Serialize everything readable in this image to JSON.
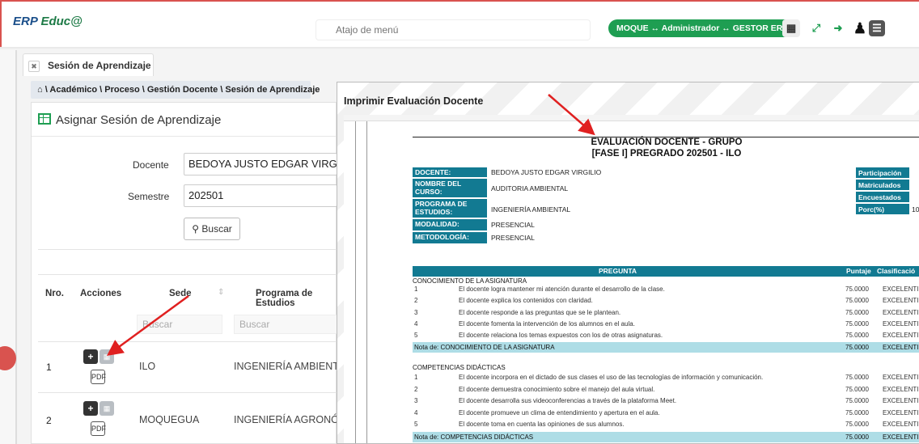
{
  "topbar": {
    "logo_prefix": "ERP",
    "logo_suffix": "Educ@",
    "search_placeholder": "Atajo de menú",
    "role_pill": "MOQUE ↔ Administrador ↔ GESTOR ERP",
    "icons": [
      "apps-grid-icon",
      "fullscreen-icon",
      "logout-icon",
      "user-icon",
      "hamburger-menu-icon"
    ]
  },
  "tab": {
    "label": "Sesión de Aprendizaje"
  },
  "breadcrumb": "\\ Académico \\ Proceso \\ Gestión Docente \\ Sesión de Aprendizaje",
  "panel": {
    "title": "Asignar Sesión de Aprendizaje",
    "docente_label": "Docente",
    "docente_value": "BEDOYA JUSTO EDGAR VIRGILIO",
    "semestre_label": "Semestre",
    "semestre_value": "202501",
    "buscar_label": "Buscar",
    "columns": {
      "nro": "Nro.",
      "acciones": "Acciones",
      "sede": "Sede",
      "programa": "Programa de Estudios"
    },
    "filter_placeholder": "Buscar",
    "rows": [
      {
        "nro": "1",
        "sede": "ILO",
        "programa": "INGENIERÍA AMBIENTAL"
      },
      {
        "nro": "2",
        "sede": "MOQUEGUA",
        "programa": "INGENIERÍA AGRONÓMICA"
      }
    ]
  },
  "modal": {
    "title": "Imprimir Evaluación Docente",
    "doc": {
      "title_line1": "EVALUACIÓN DOCENTE - GRUPO",
      "title_line2": "[FASE I] PREGRADO 202501 - ILO",
      "info": [
        {
          "label": "DOCENTE:",
          "value": "BEDOYA JUSTO EDGAR VIRGILIO"
        },
        {
          "label": "NOMBRE DEL CURSO:",
          "value": "AUDITORIA AMBIENTAL"
        },
        {
          "label": "PROGRAMA DE ESTUDIOS:",
          "value": "INGENIERÍA AMBIENTAL"
        },
        {
          "label": "MODALIDAD:",
          "value": "PRESENCIAL"
        },
        {
          "label": "METODOLOGÍA:",
          "value": "PRESENCIAL"
        }
      ],
      "stats": [
        {
          "label": "Participación",
          "value": ""
        },
        {
          "label": "Matriculados",
          "value": ""
        },
        {
          "label": "Encuestados",
          "value": ""
        },
        {
          "label": "Porc(%)",
          "value": "10"
        }
      ],
      "table_header": {
        "pregunta": "PREGUNTA",
        "puntaje": "Puntaje",
        "clasificacion": "Clasificació"
      },
      "sections": [
        {
          "title": "CONOCIMIENTO DE LA ASIGNATURA",
          "questions": [
            {
              "n": "1",
              "text": "El docente logra mantener mi atención durante el desarrollo de la clase.",
              "score": "75.0000",
              "class": "EXCELENTI"
            },
            {
              "n": "2",
              "text": "El docente explica los contenidos con claridad.",
              "score": "75.0000",
              "class": "EXCELENTI"
            },
            {
              "n": "3",
              "text": "El docente responde a las preguntas que se le plantean.",
              "score": "75.0000",
              "class": "EXCELENTI"
            },
            {
              "n": "4",
              "text": "El docente fomenta la intervención de los alumnos en el aula.",
              "score": "75.0000",
              "class": "EXCELENTI"
            },
            {
              "n": "5",
              "text": "El docente relaciona los temas expuestos con los de otras asignaturas.",
              "score": "75.0000",
              "class": "EXCELENTI"
            }
          ],
          "nota_label": "Nota de: CONOCIMIENTO DE LA ASIGNATURA",
          "nota_score": "75.0000",
          "nota_class": "EXCELENTI"
        },
        {
          "title": "COMPETENCIAS DIDÁCTICAS",
          "questions": [
            {
              "n": "1",
              "text": "El docente incorpora en el dictado de sus clases el uso de las tecnologías de información y comunicación.",
              "score": "75.0000",
              "class": "EXCELENTI"
            },
            {
              "n": "2",
              "text": "El docente demuestra conocimiento sobre el manejo del aula virtual.",
              "score": "75.0000",
              "class": "EXCELENTI"
            },
            {
              "n": "3",
              "text": "El docente desarrolla sus videoconferencias a través de la plataforma Meet.",
              "score": "75.0000",
              "class": "EXCELENTI"
            },
            {
              "n": "4",
              "text": "El docente promueve un clima de entendimiento y apertura en el aula.",
              "score": "75.0000",
              "class": "EXCELENTI"
            },
            {
              "n": "5",
              "text": "El docente toma en cuenta las opiniones de sus alumnos.",
              "score": "75.0000",
              "class": "EXCELENTI"
            }
          ],
          "nota_label": "Nota de: COMPETENCIAS DIDÁCTICAS",
          "nota_score": "75.0000",
          "nota_class": "EXCELENTI"
        }
      ]
    }
  },
  "colors": {
    "brand_green": "#1e9e52",
    "doc_teal": "#127a92",
    "nota_bg": "#aedde6",
    "annotation_red": "#e02020"
  }
}
